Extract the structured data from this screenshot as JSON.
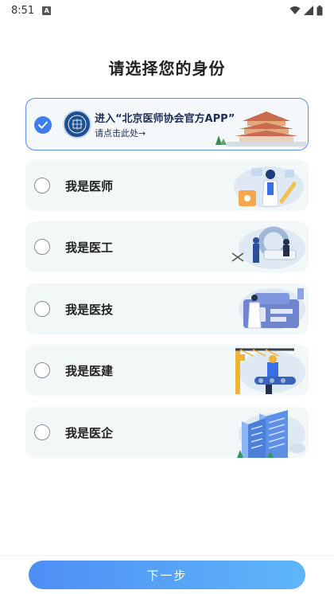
{
  "status_bar": {
    "time": "8:51",
    "notification_glyph": "A",
    "icons": [
      "wifi-icon",
      "signal-icon",
      "battery-icon"
    ]
  },
  "page": {
    "title": "请选择您的身份"
  },
  "featured_option": {
    "title": "进入“北京医师协会官方APP”",
    "subtitle": "请点击此处→",
    "selected": true,
    "icons": [
      "check-icon",
      "association-logo-icon",
      "temple-illustration-icon"
    ]
  },
  "identity_options": [
    {
      "label": "我是医师",
      "selected": false,
      "icon": "doctor-illustration-icon"
    },
    {
      "label": "我是医工",
      "selected": false,
      "icon": "engineer-illustration-icon"
    },
    {
      "label": "我是医技",
      "selected": false,
      "icon": "technician-illustration-icon"
    },
    {
      "label": "我是医建",
      "selected": false,
      "icon": "construction-illustration-icon"
    },
    {
      "label": "我是医企",
      "selected": false,
      "icon": "enterprise-illustration-icon"
    }
  ],
  "footer": {
    "next_label": "下一步"
  },
  "colors": {
    "accent": "#3f7cf0",
    "button_gradient_start": "#4e8ef5",
    "button_gradient_end": "#5fb6f8",
    "card_background": "#f2f7f8"
  }
}
